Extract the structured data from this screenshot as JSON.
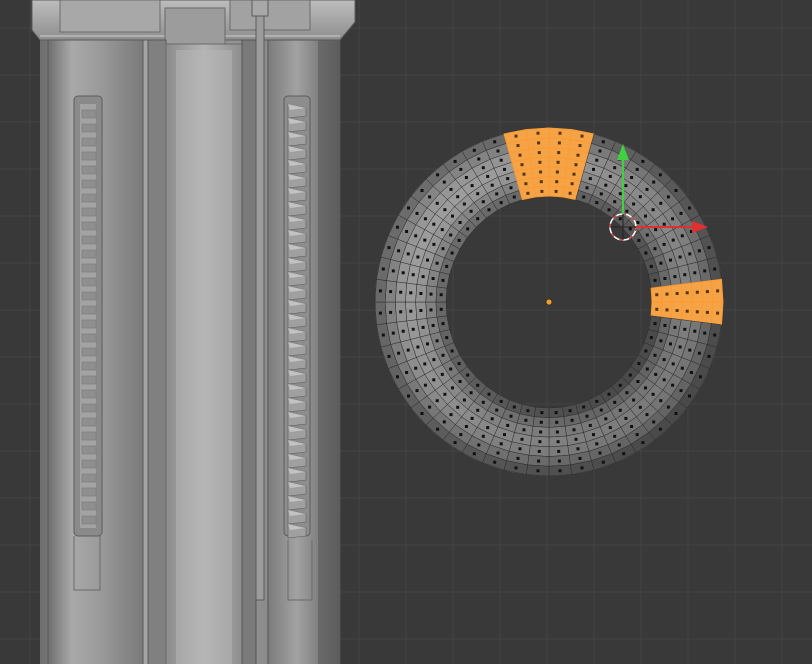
{
  "viewport": {
    "background": "#393939",
    "grid_color": "#444444",
    "view": "3d-viewport-edit-mode"
  },
  "colors": {
    "selection": "#ff9a2e",
    "selection_fill": "#f4a347",
    "mesh_face": "#8a8a8a",
    "mesh_edge": "#2a2a2a",
    "gizmo_x": "#e03030",
    "gizmo_y": "#40d040",
    "cursor": "#ffffff",
    "origin": "#e8a03a"
  },
  "torus": {
    "major_segments": 48,
    "minor_rings": 7,
    "selected_edge_loops": 2
  },
  "icons": [
    "3d-cursor-icon",
    "translate-gizmo-icon",
    "object-origin-icon"
  ]
}
